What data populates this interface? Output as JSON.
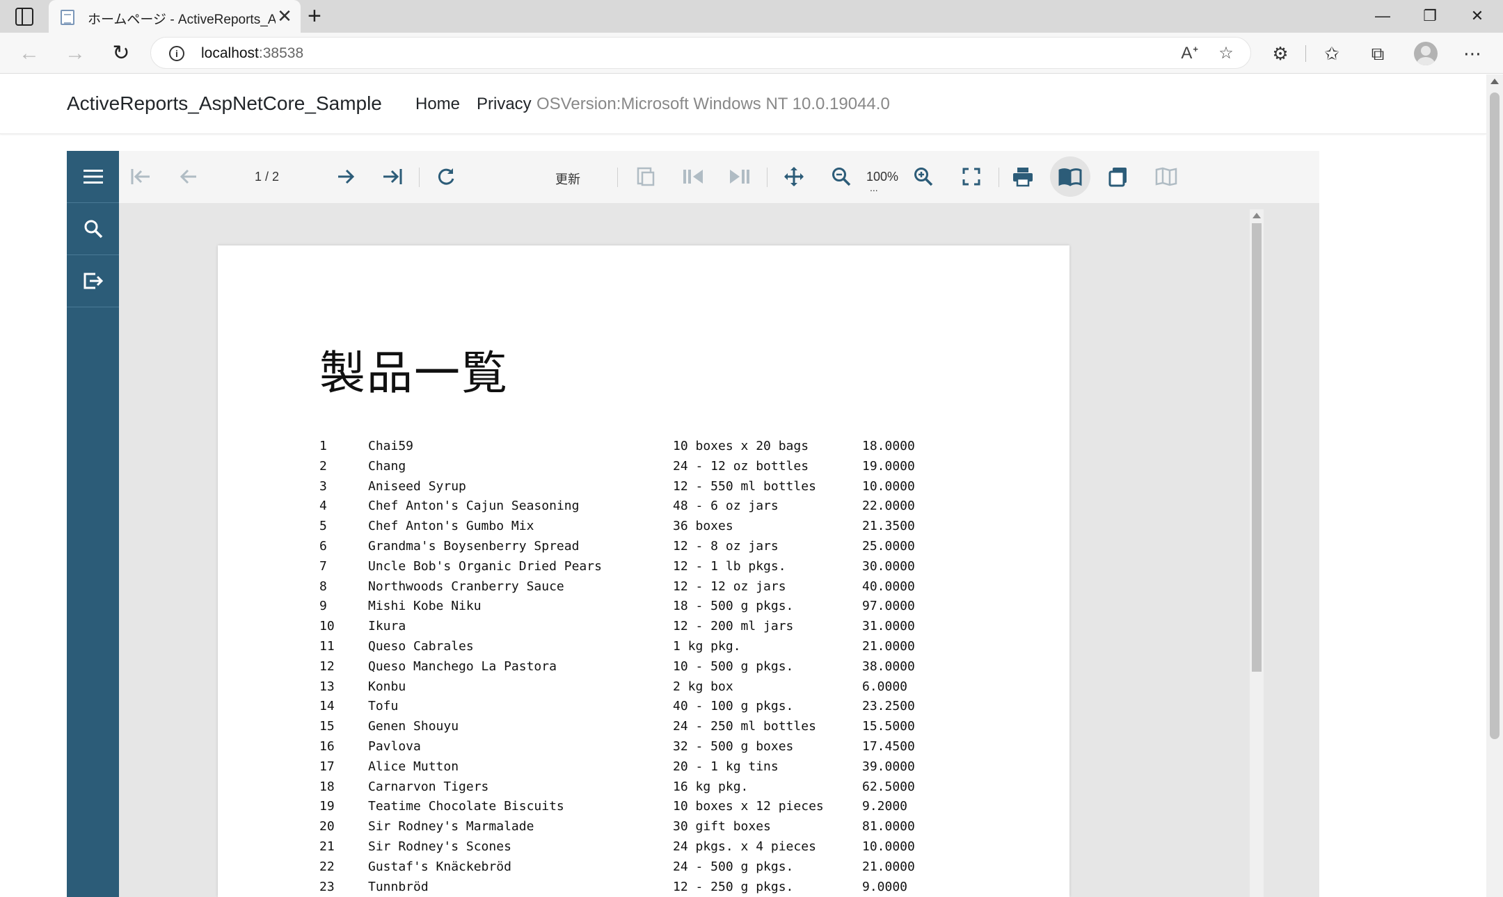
{
  "browser": {
    "tab_title": "ホームページ - ActiveReports_AspNetCore_Sample",
    "tab_close": "✕",
    "new_tab": "+",
    "url_host": "localhost",
    "url_port": ":38538",
    "window_controls": {
      "minimize": "—",
      "restore": "❐",
      "close": "✕"
    },
    "icons": [
      "tab-actions-icon",
      "back-icon",
      "forward-icon",
      "refresh-icon",
      "info-icon",
      "read-aloud-icon",
      "add-favorite-icon",
      "extensions-icon",
      "favorites-icon",
      "collections-icon",
      "profile-icon",
      "more-icon"
    ]
  },
  "site": {
    "brand": "ActiveReports_AspNetCore_Sample",
    "nav": [
      "Home",
      "Privacy"
    ],
    "os_version": "OSVersion:Microsoft Windows NT 10.0.19044.0"
  },
  "viewer": {
    "page_indicator": "1 / 2",
    "refresh_label": "更新",
    "zoom": "100%",
    "zoom_more": "...",
    "sidebar_icons": [
      "menu-icon",
      "search-icon",
      "export-icon"
    ],
    "accent_color": "#2c5c78"
  },
  "report": {
    "title": "製品一覧",
    "rows": [
      {
        "id": "1",
        "name": "Chai59",
        "qty": "10 boxes x 20 bags",
        "price": "18.0000"
      },
      {
        "id": "2",
        "name": "Chang",
        "qty": "24 - 12 oz bottles",
        "price": "19.0000"
      },
      {
        "id": "3",
        "name": "Aniseed Syrup",
        "qty": "12 - 550 ml bottles",
        "price": "10.0000"
      },
      {
        "id": "4",
        "name": "Chef Anton's Cajun Seasoning",
        "qty": "48 - 6 oz jars",
        "price": "22.0000"
      },
      {
        "id": "5",
        "name": "Chef Anton's Gumbo Mix",
        "qty": "36 boxes",
        "price": "21.3500"
      },
      {
        "id": "6",
        "name": "Grandma's Boysenberry Spread",
        "qty": "12 - 8 oz jars",
        "price": "25.0000"
      },
      {
        "id": "7",
        "name": "Uncle Bob's Organic Dried Pears",
        "qty": "12 - 1 lb pkgs.",
        "price": "30.0000"
      },
      {
        "id": "8",
        "name": "Northwoods Cranberry Sauce",
        "qty": "12 - 12 oz jars",
        "price": "40.0000"
      },
      {
        "id": "9",
        "name": "Mishi Kobe Niku",
        "qty": "18 - 500 g pkgs.",
        "price": "97.0000"
      },
      {
        "id": "10",
        "name": "Ikura",
        "qty": "12 - 200 ml jars",
        "price": "31.0000"
      },
      {
        "id": "11",
        "name": "Queso Cabrales",
        "qty": "1 kg pkg.",
        "price": "21.0000"
      },
      {
        "id": "12",
        "name": "Queso Manchego La Pastora",
        "qty": "10 - 500 g pkgs.",
        "price": "38.0000"
      },
      {
        "id": "13",
        "name": "Konbu",
        "qty": "2 kg box",
        "price": "6.0000"
      },
      {
        "id": "14",
        "name": "Tofu",
        "qty": "40 - 100 g pkgs.",
        "price": "23.2500"
      },
      {
        "id": "15",
        "name": "Genen Shouyu",
        "qty": "24 - 250 ml bottles",
        "price": "15.5000"
      },
      {
        "id": "16",
        "name": "Pavlova",
        "qty": "32 - 500 g boxes",
        "price": "17.4500"
      },
      {
        "id": "17",
        "name": "Alice Mutton",
        "qty": "20 - 1 kg tins",
        "price": "39.0000"
      },
      {
        "id": "18",
        "name": "Carnarvon Tigers",
        "qty": "16 kg pkg.",
        "price": "62.5000"
      },
      {
        "id": "19",
        "name": "Teatime Chocolate Biscuits",
        "qty": "10 boxes x 12 pieces",
        "price": "9.2000"
      },
      {
        "id": "20",
        "name": "Sir Rodney's Marmalade",
        "qty": "30 gift boxes",
        "price": "81.0000"
      },
      {
        "id": "21",
        "name": "Sir Rodney's Scones",
        "qty": "24 pkgs. x 4 pieces",
        "price": "10.0000"
      },
      {
        "id": "22",
        "name": "Gustaf's Knäckebröd",
        "qty": "24 - 500 g pkgs.",
        "price": "21.0000"
      },
      {
        "id": "23",
        "name": "Tunnbröd",
        "qty": "12 - 250 g pkgs.",
        "price": "9.0000"
      }
    ]
  }
}
